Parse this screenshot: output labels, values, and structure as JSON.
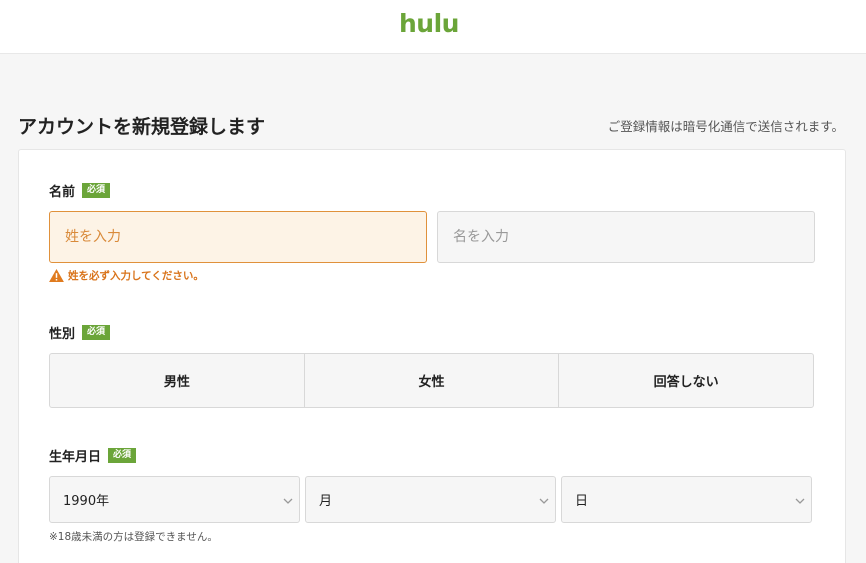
{
  "header": {
    "logo": "hulu"
  },
  "page": {
    "title": "アカウントを新規登録します",
    "secure_note": "ご登録情報は暗号化通信で送信されます。"
  },
  "form": {
    "required_badge": "必須",
    "name": {
      "label": "名前",
      "last_placeholder": "姓を入力",
      "first_placeholder": "名を入力",
      "error": "姓を必ず入力してください。"
    },
    "gender": {
      "label": "性別",
      "options": [
        "男性",
        "女性",
        "回答しない"
      ]
    },
    "birthdate": {
      "label": "生年月日",
      "year": "1990年",
      "month": "月",
      "day": "日",
      "note": "※18歳未満の方は登録できません。"
    }
  },
  "colors": {
    "brand": "#6ba539",
    "error": "#d9741c",
    "error_bg": "#fdf3e6"
  }
}
